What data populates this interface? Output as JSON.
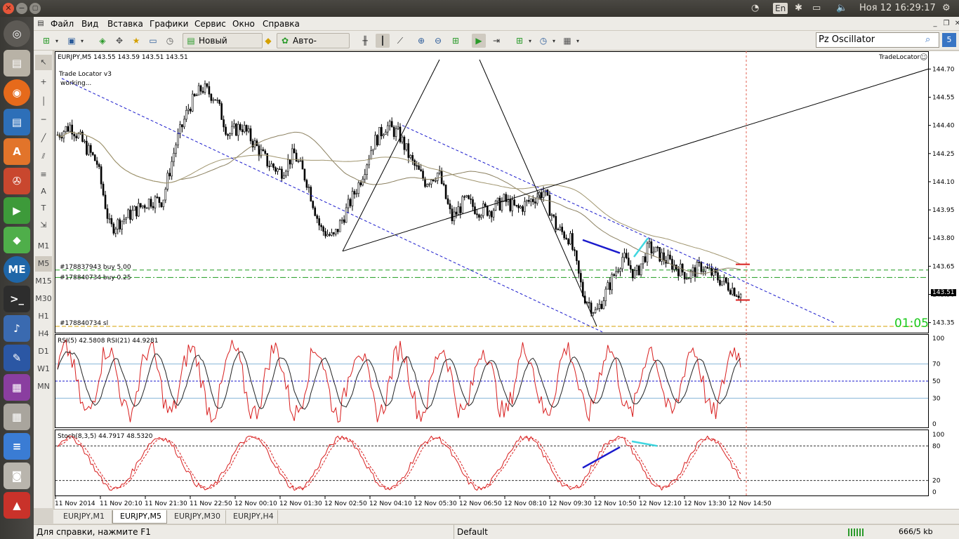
{
  "system": {
    "keyboard_layout": "En",
    "clock": "Ноя 12 16:29:17"
  },
  "menu": [
    "Файл",
    "Вид",
    "Вставка",
    "Графики",
    "Сервис",
    "Окно",
    "Справка"
  ],
  "toolbar": {
    "new_order_label": "Новый Ордер",
    "autotrading_label": "Авто-торговля",
    "search_value": "Pz Oscillator",
    "count_badge": "5"
  },
  "left_toolbar": {
    "timeframes": [
      "M1",
      "M5",
      "M15",
      "M30",
      "H1",
      "H4",
      "D1",
      "W1",
      "MN"
    ]
  },
  "chart": {
    "header": "EURJPY,M5  143.55 143.59 143.51 143.51",
    "indicator_title": "Trade Locator v3",
    "indicator_status": "working...",
    "tradelocator_label": "TradeLocator",
    "order1": "#178837943 buy 5.00",
    "order2": "#178840734 buy 0.25",
    "order3": "#178840734 sl",
    "timer": "01:05",
    "current_price": "143.51",
    "price_ticks": [
      "144.70",
      "144.55",
      "144.40",
      "144.25",
      "144.10",
      "143.95",
      "143.80",
      "143.65",
      "143.50",
      "143.35"
    ],
    "rsi_header": "RSI(5) 42.5808  RSI(21) 44.9281",
    "rsi_ticks": [
      "100",
      "70",
      "50",
      "30",
      "0"
    ],
    "stoch_header": "Stoch(8,3,5) 44.7917 48.5320",
    "stoch_ticks": [
      "100",
      "80",
      "20",
      "0"
    ],
    "time_labels": [
      "11 Nov 2014",
      "11 Nov 20:10",
      "11 Nov 21:30",
      "11 Nov 22:50",
      "12 Nov 00:10",
      "12 Nov 01:30",
      "12 Nov 02:50",
      "12 Nov 04:10",
      "12 Nov 05:30",
      "12 Nov 06:50",
      "12 Nov 08:10",
      "12 Nov 09:30",
      "12 Nov 10:50",
      "12 Nov 12:10",
      "12 Nov 13:30",
      "12 Nov 14:50"
    ],
    "colors": {
      "bull": "#000000",
      "bear": "#000000",
      "rsi_fast": "#d81e1e",
      "rsi_slow": "#222222",
      "stoch_main": "#d81e1e",
      "order_line": "#1e9b1e",
      "sl_line": "#d4a000",
      "channel": "#1a1acc"
    }
  },
  "chart_data": {
    "type": "candlestick",
    "symbol": "EURJPY",
    "timeframe": "M5",
    "close_path": [
      144.35,
      144.4,
      144.3,
      144.2,
      143.85,
      143.9,
      143.95,
      144.0,
      144.0,
      144.3,
      144.5,
      144.6,
      144.55,
      144.35,
      144.4,
      144.3,
      144.2,
      144.15,
      144.25,
      144.1,
      143.85,
      143.8,
      143.95,
      144.1,
      144.3,
      144.4,
      144.35,
      144.2,
      144.1,
      144.15,
      143.9,
      144.0,
      143.95,
      143.95,
      144.0,
      143.95,
      144.0,
      144.05,
      143.85,
      143.8,
      143.5,
      143.4,
      143.55,
      143.7,
      143.6,
      143.75,
      143.7,
      143.65,
      143.6,
      143.65,
      143.6,
      143.55,
      143.5
    ],
    "ylim": [
      143.3,
      144.75
    ],
    "rsi_ylim": [
      0,
      100
    ],
    "stoch_ylim": [
      0,
      100
    ]
  },
  "tabs": [
    "EURJPY,M1",
    "EURJPY,M5",
    "EURJPY,M30",
    "EURJPY,H4"
  ],
  "status": {
    "help": "Для справки, нажмите F1",
    "profile": "Default",
    "traffic": "666/5 kb"
  }
}
